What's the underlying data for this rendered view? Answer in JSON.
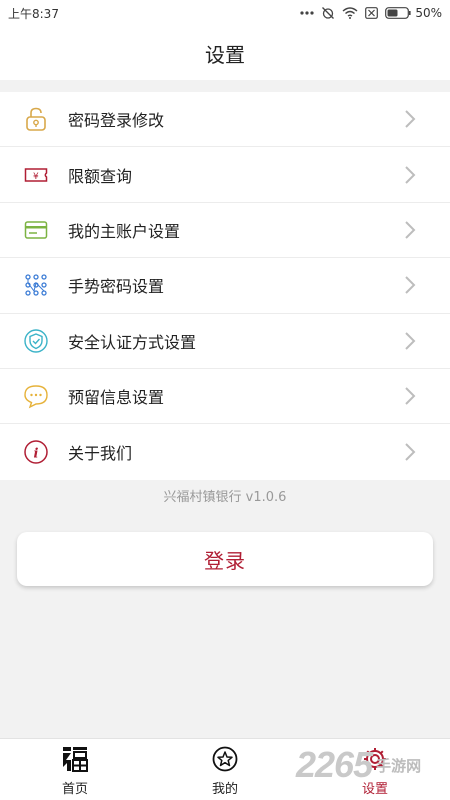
{
  "status_bar": {
    "time": "上午8:37",
    "battery": "50%"
  },
  "header": {
    "title": "设置"
  },
  "menu": {
    "items": [
      {
        "label": "密码登录修改",
        "icon": "lock-icon",
        "color": "#d8a84a"
      },
      {
        "label": "限额查询",
        "icon": "ticket-icon",
        "color": "#b01e34"
      },
      {
        "label": "我的主账户设置",
        "icon": "card-icon",
        "color": "#7cb342"
      },
      {
        "label": "手势密码设置",
        "icon": "gesture-grid-icon",
        "color": "#3a7bd5"
      },
      {
        "label": "安全认证方式设置",
        "icon": "shield-icon",
        "color": "#3bb3c8"
      },
      {
        "label": "预留信息设置",
        "icon": "chat-bubble-icon",
        "color": "#e6b23a"
      },
      {
        "label": "关于我们",
        "icon": "info-icon",
        "color": "#b01e34"
      }
    ]
  },
  "version_text": "兴福村镇银行   v1.0.6",
  "login_button": {
    "label": "登录"
  },
  "tabs": [
    {
      "label": "首页",
      "icon": "bank-logo-icon",
      "active": false
    },
    {
      "label": "我的",
      "icon": "star-circle-icon",
      "active": false
    },
    {
      "label": "设置",
      "icon": "gear-icon",
      "active": true
    }
  ],
  "watermark": {
    "number": "2265",
    "text": "手游网"
  },
  "colors": {
    "accent": "#b01e34"
  }
}
